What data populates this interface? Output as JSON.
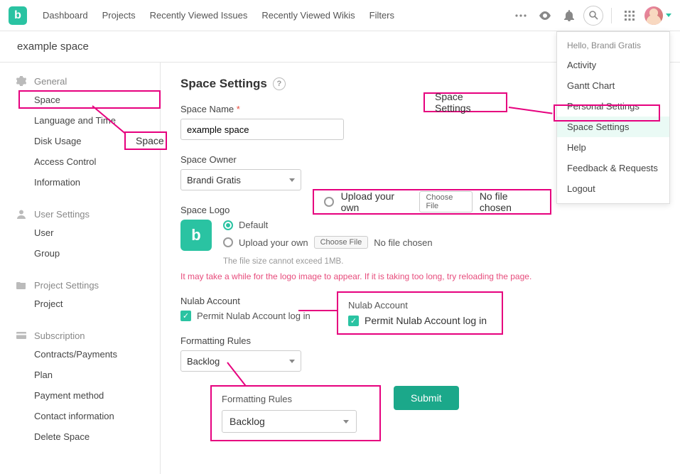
{
  "topnav": {
    "items": [
      "Dashboard",
      "Projects",
      "Recently Viewed Issues",
      "Recently Viewed Wikis",
      "Filters"
    ]
  },
  "subheader": {
    "title": "example space"
  },
  "sidebar": {
    "groups": [
      {
        "label": "General",
        "items": [
          "Space",
          "Language and Time",
          "Disk Usage",
          "Access Control",
          "Information"
        ]
      },
      {
        "label": "User Settings",
        "items": [
          "User",
          "Group"
        ]
      },
      {
        "label": "Project Settings",
        "items": [
          "Project"
        ]
      },
      {
        "label": "Subscription",
        "items": [
          "Contracts/Payments",
          "Plan",
          "Payment method",
          "Contact information",
          "Delete Space"
        ]
      }
    ]
  },
  "page": {
    "title": "Space Settings",
    "space_name": {
      "label": "Space Name",
      "value": "example space"
    },
    "space_owner": {
      "label": "Space Owner",
      "value": "Brandi Gratis"
    },
    "space_logo": {
      "label": "Space Logo",
      "default_label": "Default",
      "upload_label": "Upload your own",
      "choose_label": "Choose File",
      "no_file": "No file chosen",
      "hint": "The file size cannot exceed 1MB.",
      "warn": "It may take a while for the logo image to appear. If it is taking too long, try reloading the page."
    },
    "nulab": {
      "label": "Nulab Account",
      "permit_label": "Permit Nulab Account log in"
    },
    "formatting": {
      "label": "Formatting Rules",
      "value": "Backlog"
    },
    "submit": "Submit"
  },
  "user_menu": {
    "hello": "Hello, Brandi Gratis",
    "items": [
      "Activity",
      "Gantt Chart",
      "Personal Settings",
      "Space Settings",
      "Help",
      "Feedback & Requests",
      "Logout"
    ],
    "highlight_index": 3
  },
  "callouts": {
    "space_label": "Space",
    "space_settings_label": "Space Settings",
    "upload": {
      "label": "Upload your own",
      "choose": "Choose File",
      "nofile": "No file chosen"
    },
    "nulab": {
      "title": "Nulab Account",
      "permit": "Permit Nulab Account log in"
    },
    "formatting": {
      "title": "Formatting Rules",
      "value": "Backlog"
    }
  }
}
